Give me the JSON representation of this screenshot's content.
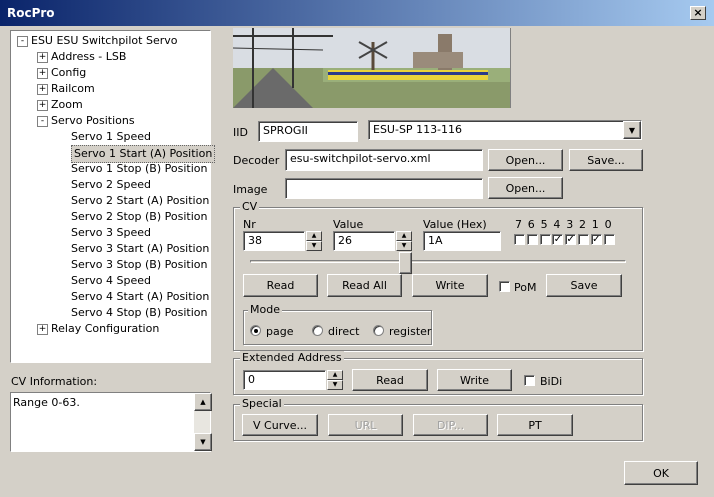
{
  "window": {
    "title": "RocPro",
    "close": "×"
  },
  "tree": {
    "root": "ESU ESU Switchpilot Servo",
    "items": [
      "Address - LSB",
      "Config",
      "Railcom",
      "Zoom",
      "Servo Positions"
    ],
    "servo_children": [
      "Servo 1 Speed",
      "Servo 1 Start (A) Position",
      "Servo 1 Stop (B) Position",
      "Servo 2 Speed",
      "Servo 2 Start (A) Position",
      "Servo 2 Stop (B) Position",
      "Servo 3 Speed",
      "Servo 3 Start (A) Position",
      "Servo 3 Stop (B) Position",
      "Servo 4 Speed",
      "Servo 4 Start (A) Position",
      "Servo 4 Stop (B) Position"
    ],
    "last": "Relay Configuration",
    "selected": "Servo 1 Start (A) Position"
  },
  "cv_info": {
    "label": "CV Information:",
    "text": "Range 0-63."
  },
  "iid": {
    "label": "IID",
    "value": "SPROGII",
    "device": "ESU-SP 113-116"
  },
  "decoder": {
    "label": "Decoder",
    "file": "esu-switchpilot-servo.xml",
    "open": "Open...",
    "save": "Save..."
  },
  "image": {
    "label": "Image",
    "value": "",
    "open": "Open..."
  },
  "cv": {
    "group": "CV",
    "nr_label": "Nr",
    "nr": "38",
    "value_label": "Value",
    "value": "26",
    "hex_label": "Value (Hex)",
    "hex": "1A",
    "bits": [
      "7",
      "6",
      "5",
      "4",
      "3",
      "2",
      "1",
      "0"
    ],
    "bit_states": [
      false,
      false,
      false,
      true,
      true,
      false,
      true,
      false
    ],
    "slider": 0.41,
    "read": "Read",
    "read_all": "Read All",
    "write": "Write",
    "pom": "PoM",
    "save": "Save",
    "mode_label": "Mode",
    "modes": [
      "page",
      "direct",
      "register"
    ],
    "mode_selected": "page"
  },
  "ext": {
    "group": "Extended Address",
    "value": "0",
    "read": "Read",
    "write": "Write",
    "bidi": "BiDi"
  },
  "special": {
    "group": "Special",
    "vcurve": "V Curve...",
    "url": "URL",
    "dip": "DIP...",
    "pt": "PT"
  },
  "ok": "OK"
}
